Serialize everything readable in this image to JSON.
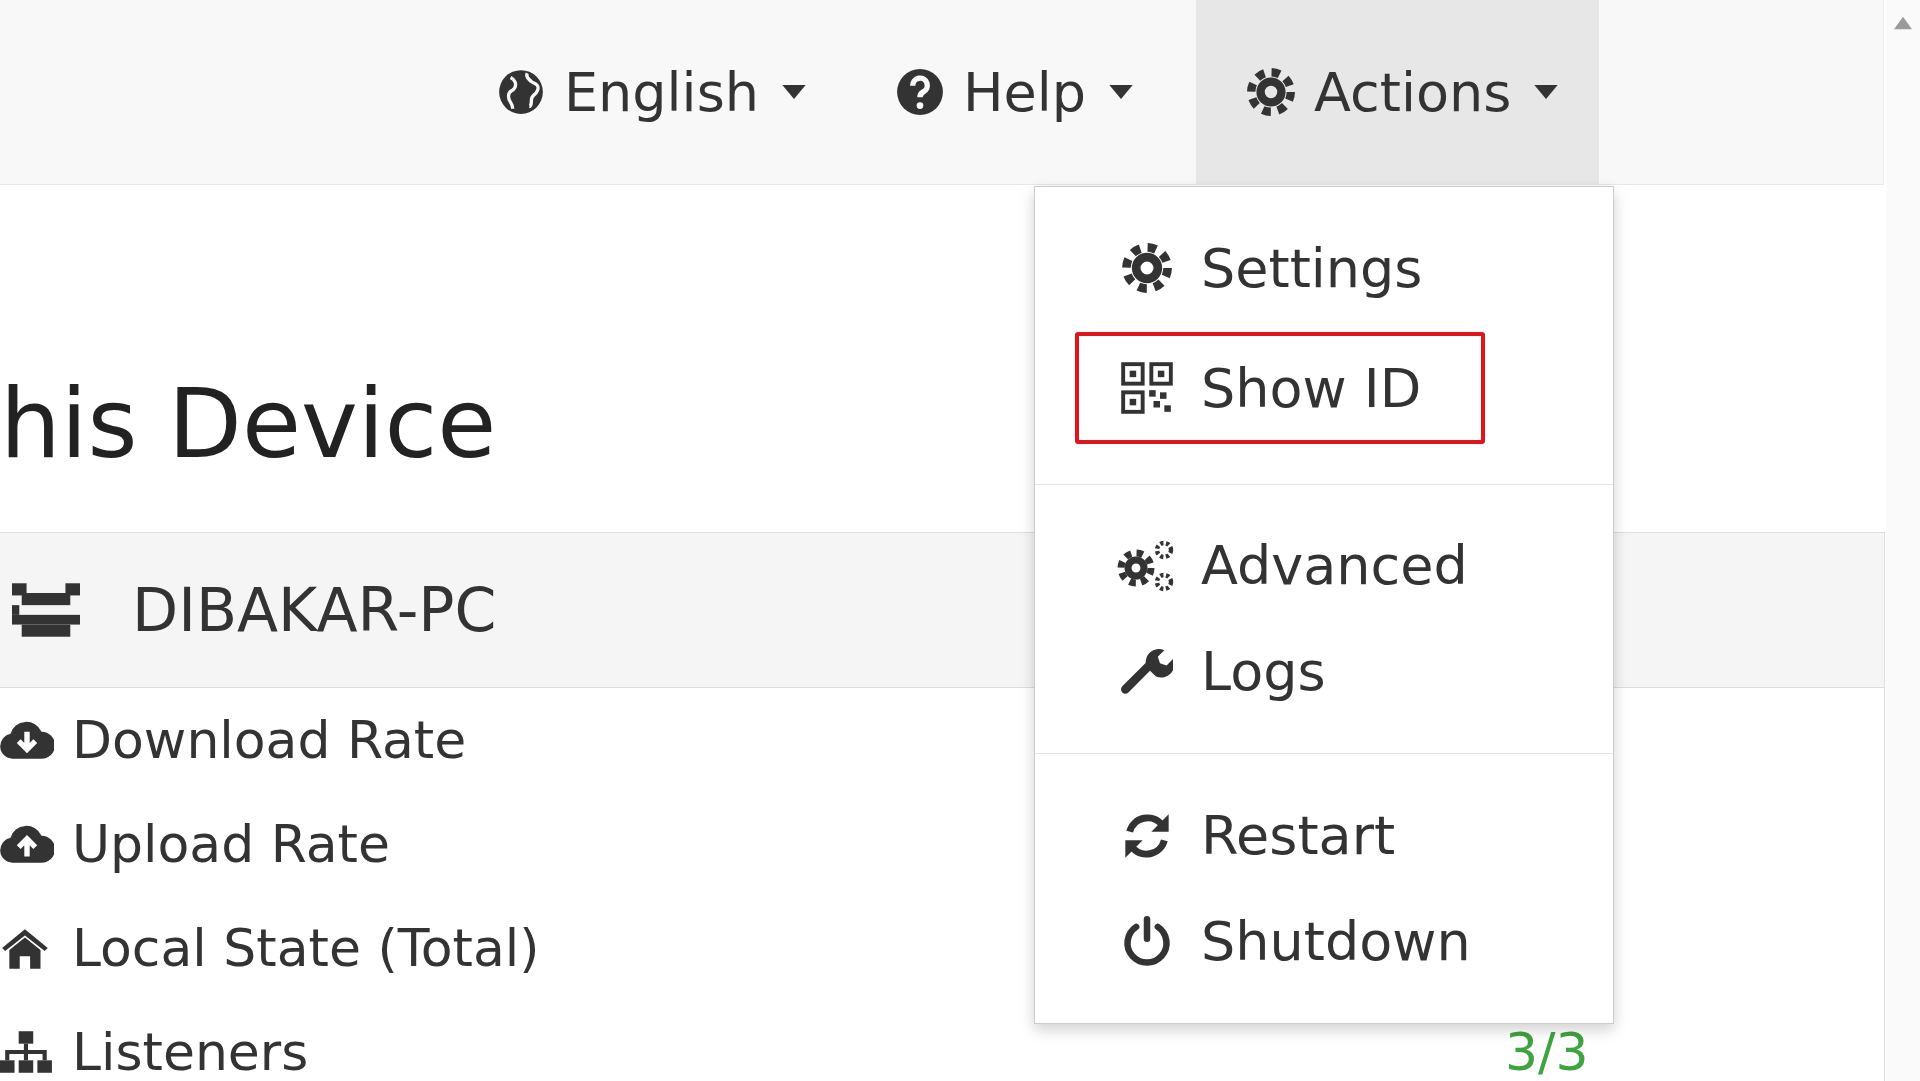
{
  "navbar": {
    "menus": [
      {
        "label": "English",
        "kind": "language",
        "open": false
      },
      {
        "label": "Help",
        "kind": "help",
        "open": false
      },
      {
        "label": "Actions",
        "kind": "actions",
        "open": true
      }
    ]
  },
  "actions_menu": {
    "groups": [
      {
        "items": [
          {
            "label": "Settings",
            "kind": "settings",
            "highlighted": false
          },
          {
            "label": "Show ID",
            "kind": "qr",
            "highlighted": true
          }
        ]
      },
      {
        "items": [
          {
            "label": "Advanced",
            "kind": "advanced",
            "highlighted": false
          },
          {
            "label": "Logs",
            "kind": "logs",
            "highlighted": false
          }
        ]
      },
      {
        "items": [
          {
            "label": "Restart",
            "kind": "restart",
            "highlighted": false
          },
          {
            "label": "Shutdown",
            "kind": "shutdown",
            "highlighted": false
          }
        ]
      }
    ]
  },
  "device": {
    "title": "his Device",
    "name": "DIBAKAR-PC",
    "rows": [
      {
        "label": "Download Rate",
        "kind": "download"
      },
      {
        "label": "Upload Rate",
        "kind": "upload"
      },
      {
        "label": "Local State (Total)",
        "kind": "home"
      },
      {
        "label": "Listeners",
        "kind": "listeners",
        "value": "3/3"
      }
    ]
  }
}
